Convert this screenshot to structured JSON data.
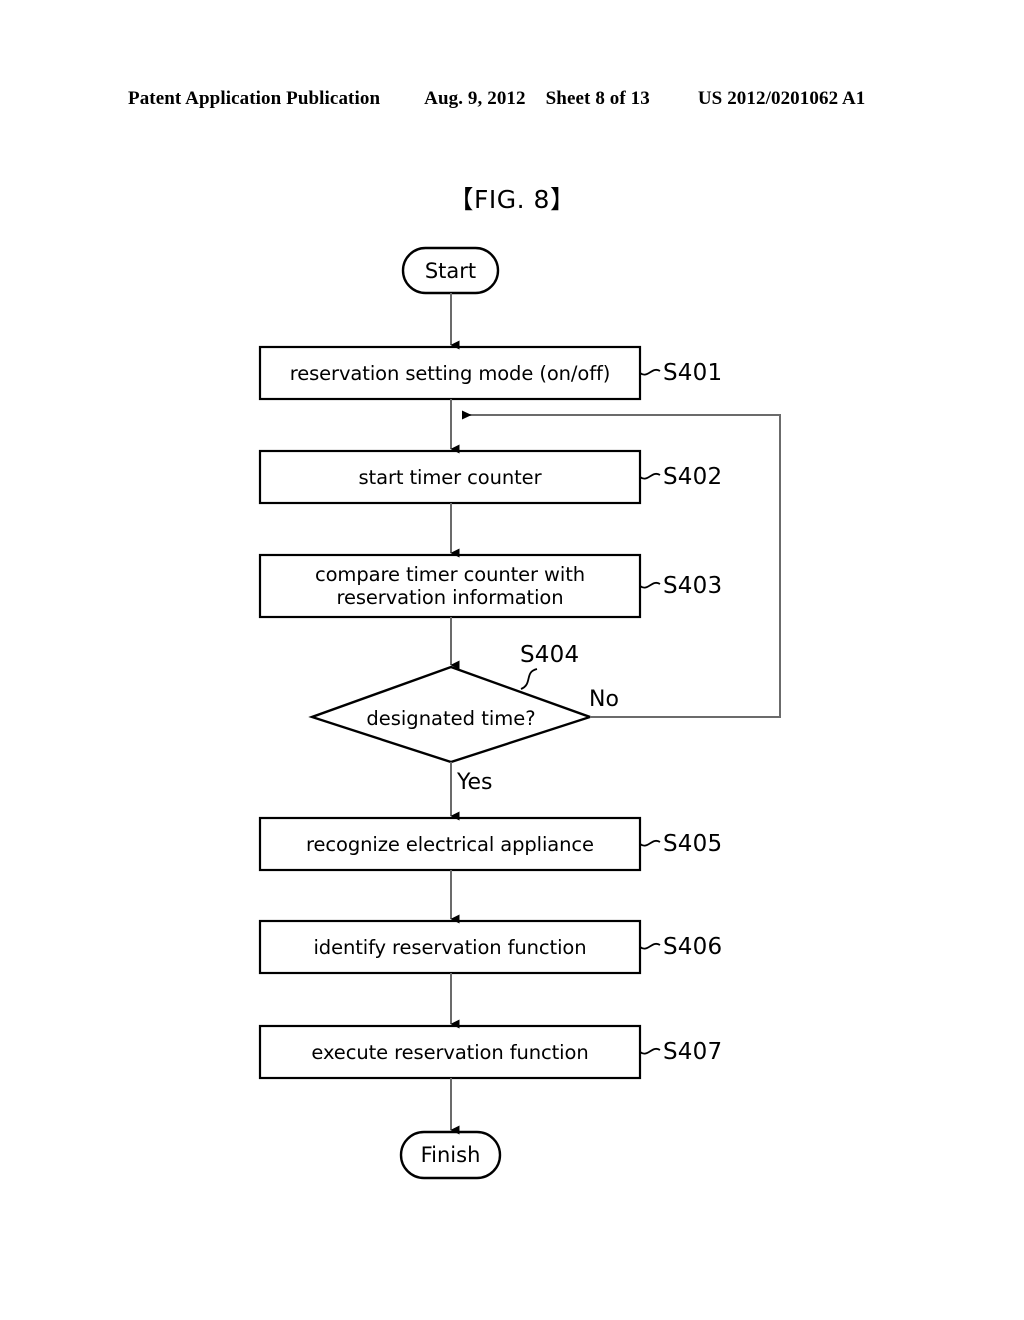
{
  "header": {
    "publication": "Patent Application Publication",
    "date": "Aug. 9, 2012",
    "sheet": "Sheet 8 of 13",
    "number": "US 2012/0201062 A1"
  },
  "figure": {
    "title": "【FIG. 8】"
  },
  "flowchart": {
    "start": {
      "label": "Start"
    },
    "finish": {
      "label": "Finish"
    },
    "steps": [
      {
        "id": "S401",
        "label": "reservation setting mode (on/off)",
        "tag": "S401"
      },
      {
        "id": "S402",
        "label": "start timer counter",
        "tag": "S402"
      },
      {
        "id": "S403",
        "label": "compare timer counter with\nreservation information",
        "tag": "S403"
      },
      {
        "id": "S405",
        "label": "recognize electrical appliance",
        "tag": "S405"
      },
      {
        "id": "S406",
        "label": "identify reservation function",
        "tag": "S406"
      },
      {
        "id": "S407",
        "label": "execute reservation function",
        "tag": "S407"
      }
    ],
    "decision": {
      "id": "S404",
      "label": "designated time?",
      "tag": "S404",
      "yes_label": "Yes",
      "no_label": "No"
    },
    "colors": {
      "stroke": "#000000",
      "connector": "#5a5a5a",
      "background": "#ffffff"
    }
  }
}
